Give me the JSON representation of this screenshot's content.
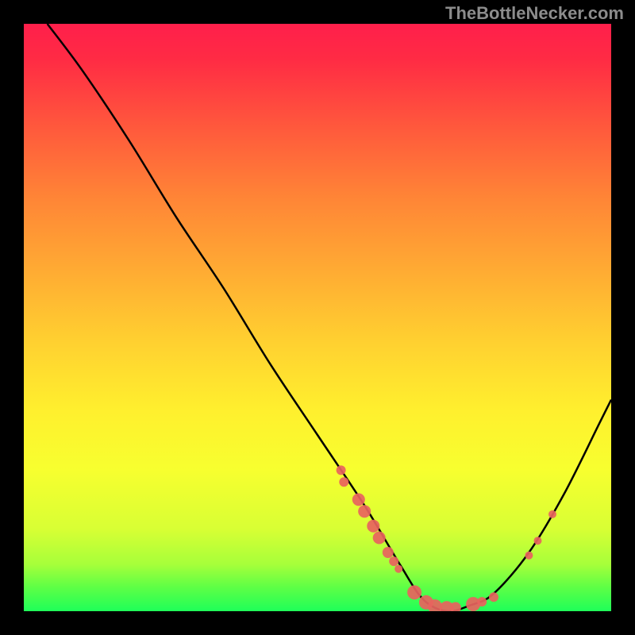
{
  "watermark": "TheBottleNecker.com",
  "chart_data": {
    "type": "line",
    "title": "",
    "xlabel": "",
    "ylabel": "",
    "xlim": [
      0,
      100
    ],
    "ylim": [
      0,
      100
    ],
    "grid": false,
    "legend": false,
    "background": "rainbow-gradient",
    "curve": [
      {
        "x": 4,
        "y": 100
      },
      {
        "x": 10,
        "y": 92
      },
      {
        "x": 18,
        "y": 80
      },
      {
        "x": 26,
        "y": 67
      },
      {
        "x": 34,
        "y": 55
      },
      {
        "x": 42,
        "y": 42
      },
      {
        "x": 50,
        "y": 30
      },
      {
        "x": 58,
        "y": 18
      },
      {
        "x": 64,
        "y": 8
      },
      {
        "x": 68,
        "y": 2
      },
      {
        "x": 72,
        "y": 0
      },
      {
        "x": 76,
        "y": 1
      },
      {
        "x": 80,
        "y": 3
      },
      {
        "x": 86,
        "y": 10
      },
      {
        "x": 92,
        "y": 20
      },
      {
        "x": 98,
        "y": 32
      },
      {
        "x": 100,
        "y": 36
      }
    ],
    "markers": [
      {
        "x": 54,
        "y": 24,
        "r": 6
      },
      {
        "x": 54.5,
        "y": 22,
        "r": 6
      },
      {
        "x": 57,
        "y": 19,
        "r": 8
      },
      {
        "x": 58,
        "y": 17,
        "r": 8
      },
      {
        "x": 59.5,
        "y": 14.5,
        "r": 8
      },
      {
        "x": 60.5,
        "y": 12.5,
        "r": 8
      },
      {
        "x": 62,
        "y": 10,
        "r": 7
      },
      {
        "x": 63,
        "y": 8.5,
        "r": 6
      },
      {
        "x": 63.8,
        "y": 7.2,
        "r": 5
      },
      {
        "x": 66.5,
        "y": 3.2,
        "r": 9
      },
      {
        "x": 68.5,
        "y": 1.5,
        "r": 9
      },
      {
        "x": 70,
        "y": 0.8,
        "r": 9
      },
      {
        "x": 72,
        "y": 0.5,
        "r": 9
      },
      {
        "x": 73.5,
        "y": 0.6,
        "r": 7
      },
      {
        "x": 76.5,
        "y": 1.2,
        "r": 9
      },
      {
        "x": 78,
        "y": 1.6,
        "r": 6
      },
      {
        "x": 80,
        "y": 2.4,
        "r": 6
      },
      {
        "x": 86,
        "y": 9.5,
        "r": 5
      },
      {
        "x": 87.5,
        "y": 12,
        "r": 5
      },
      {
        "x": 90,
        "y": 16.5,
        "r": 5
      }
    ],
    "curve_color": "#000000",
    "marker_color": "#e8635e"
  }
}
